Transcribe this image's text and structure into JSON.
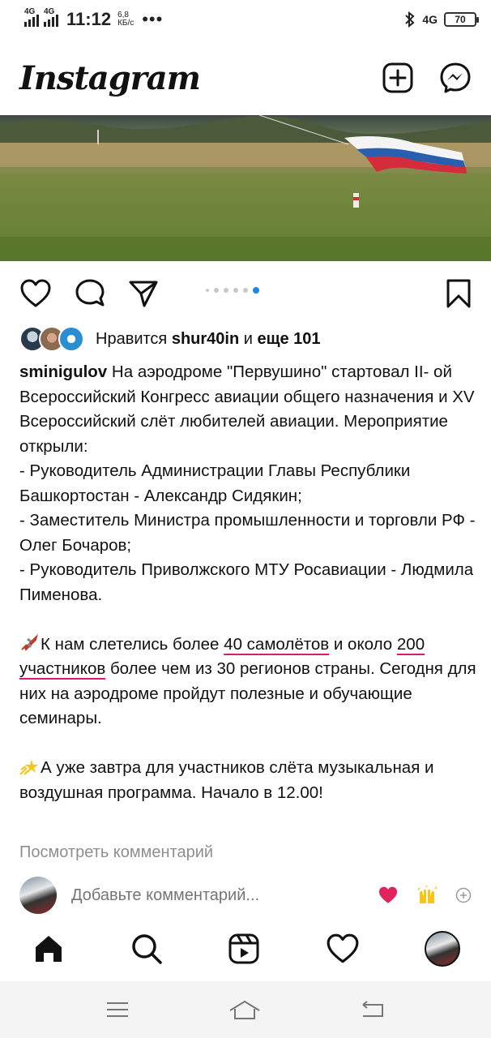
{
  "status_bar": {
    "sim1": "4G",
    "sim2": "4G",
    "time": "11:12",
    "speed_value": "6,8",
    "speed_unit": "КБ/с",
    "more": "•••",
    "network_right": "4G",
    "battery": "70"
  },
  "header": {
    "logo": "Instagram",
    "new_post_icon": "plus-square-icon",
    "messenger_icon": "messenger-icon"
  },
  "post": {
    "carousel": {
      "count": 6,
      "active_index": 5
    },
    "likes": {
      "prefix": "Нравится",
      "user": "shur40in",
      "conj": "и",
      "others": "еще 101"
    },
    "caption": {
      "username": "sminigulov",
      "intro": "На аэродроме \"Первушино\" стартовал II- ой Всероссийский Конгресс авиации общего назначения и XV Всероссийский слёт любителей авиации. Мероприятие открыли:",
      "list": [
        "- Руководитель Администрации Главы Республики Башкортостан - Александр Сидякин;",
        "- Заместитель Министра промышленности и торговли РФ - Олег Бочаров;",
        "- Руководитель Приволжского МТУ Росавиации - Людмила Пименова."
      ],
      "p2_a": "К нам слетелись более",
      "p2_u1": "40 самолётов",
      "p2_b": "и около",
      "p2_u2": "200 участников",
      "p2_c": "более чем из 30 регионов страны. Сегодня для них на аэродроме пройдут полезные и обучающие семинары.",
      "p3": "А уже завтра для участников слёта музыкальная и воздушная программа. Начало в 12.00!"
    },
    "view_comments": "Посмотреть комментарий",
    "comment_placeholder": "Добавьте комментарий..."
  },
  "colors": {
    "accent_blue": "#1e88e5",
    "underline_magenta": "#d81b7a",
    "heart_red": "#e0245e"
  }
}
